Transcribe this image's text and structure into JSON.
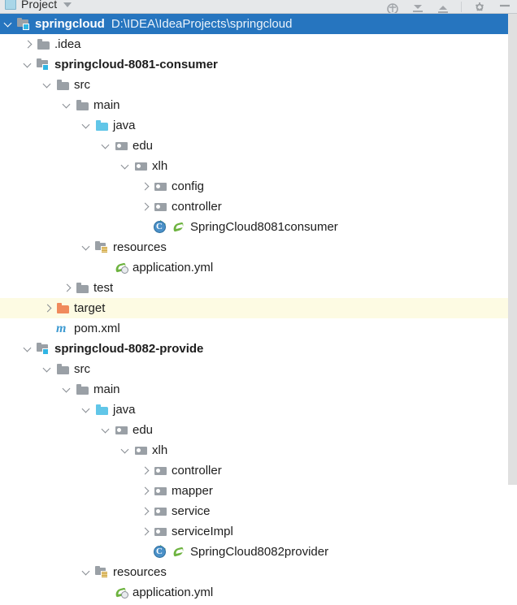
{
  "window": {
    "tool_window_title": "Project",
    "tool_window_icon": "project-icon",
    "caret_icon": "chevron-down-icon",
    "actions": [
      {
        "name": "locate-icon",
        "label": "Select Opened File"
      },
      {
        "name": "collapse-all-icon",
        "label": "Collapse All"
      },
      {
        "name": "expand-all-icon",
        "label": "Expand All"
      },
      {
        "name": "settings-icon",
        "label": "Settings"
      },
      {
        "name": "hide-icon",
        "label": "Hide"
      }
    ]
  },
  "colors": {
    "selection_blue": "#2675bf",
    "hover_yellow": "#fdfbe3",
    "folder_gray": "#9aa0a6",
    "source_root_blue": "#61c6e8",
    "excluded_orange": "#f08a5c",
    "spring_green": "#6db33f",
    "maven_blue": "#3d9ad1",
    "module_badge": "#31b5e4"
  },
  "tree": {
    "rows": [
      {
        "label": "springcloud",
        "sublabel": "D:\\IDEA\\IdeaProjects\\springcloud",
        "depth": 0,
        "icon": "module-folder-icon",
        "twisty": "open",
        "bold": true,
        "state": "selected"
      },
      {
        "label": ".idea",
        "sublabel": "",
        "depth": 1,
        "icon": "folder-icon",
        "twisty": "closed",
        "bold": false,
        "state": "normal"
      },
      {
        "label": "springcloud-8081-consumer",
        "sublabel": "",
        "depth": 1,
        "icon": "module-folder-icon",
        "twisty": "open",
        "bold": true,
        "state": "normal"
      },
      {
        "label": "src",
        "sublabel": "",
        "depth": 2,
        "icon": "folder-icon",
        "twisty": "open",
        "bold": false,
        "state": "normal"
      },
      {
        "label": "main",
        "sublabel": "",
        "depth": 3,
        "icon": "folder-icon",
        "twisty": "open",
        "bold": false,
        "state": "normal"
      },
      {
        "label": "java",
        "sublabel": "",
        "depth": 4,
        "icon": "source-root-folder-icon",
        "twisty": "open",
        "bold": false,
        "state": "normal"
      },
      {
        "label": "edu",
        "sublabel": "",
        "depth": 5,
        "icon": "package-icon",
        "twisty": "open",
        "bold": false,
        "state": "normal"
      },
      {
        "label": "xlh",
        "sublabel": "",
        "depth": 6,
        "icon": "package-icon",
        "twisty": "open",
        "bold": false,
        "state": "normal"
      },
      {
        "label": "config",
        "sublabel": "",
        "depth": 7,
        "icon": "package-icon",
        "twisty": "closed",
        "bold": false,
        "state": "normal"
      },
      {
        "label": "controller",
        "sublabel": "",
        "depth": 7,
        "icon": "package-icon",
        "twisty": "closed",
        "bold": false,
        "state": "normal"
      },
      {
        "label": "SpringCloud8081consumer",
        "sublabel": "",
        "depth": 7,
        "icon": "java-class-runnable-icon",
        "twisty": "none",
        "bold": false,
        "state": "normal",
        "extra_icon": "spring-leaf-icon"
      },
      {
        "label": "resources",
        "sublabel": "",
        "depth": 4,
        "icon": "resources-root-folder-icon",
        "twisty": "open",
        "bold": false,
        "state": "normal"
      },
      {
        "label": "application.yml",
        "sublabel": "",
        "depth": 5,
        "icon": "spring-config-icon",
        "twisty": "none",
        "bold": false,
        "state": "normal"
      },
      {
        "label": "test",
        "sublabel": "",
        "depth": 3,
        "icon": "folder-icon",
        "twisty": "closed",
        "bold": false,
        "state": "normal"
      },
      {
        "label": "target",
        "sublabel": "",
        "depth": 2,
        "icon": "excluded-folder-icon",
        "twisty": "closed",
        "bold": false,
        "state": "hovered"
      },
      {
        "label": "pom.xml",
        "sublabel": "",
        "depth": 2,
        "icon": "maven-icon",
        "twisty": "none",
        "bold": false,
        "state": "normal"
      },
      {
        "label": "springcloud-8082-provide",
        "sublabel": "",
        "depth": 1,
        "icon": "module-folder-icon",
        "twisty": "open",
        "bold": true,
        "state": "normal"
      },
      {
        "label": "src",
        "sublabel": "",
        "depth": 2,
        "icon": "folder-icon",
        "twisty": "open",
        "bold": false,
        "state": "normal"
      },
      {
        "label": "main",
        "sublabel": "",
        "depth": 3,
        "icon": "folder-icon",
        "twisty": "open",
        "bold": false,
        "state": "normal"
      },
      {
        "label": "java",
        "sublabel": "",
        "depth": 4,
        "icon": "source-root-folder-icon",
        "twisty": "open",
        "bold": false,
        "state": "normal"
      },
      {
        "label": "edu",
        "sublabel": "",
        "depth": 5,
        "icon": "package-icon",
        "twisty": "open",
        "bold": false,
        "state": "normal"
      },
      {
        "label": "xlh",
        "sublabel": "",
        "depth": 6,
        "icon": "package-icon",
        "twisty": "open",
        "bold": false,
        "state": "normal"
      },
      {
        "label": "controller",
        "sublabel": "",
        "depth": 7,
        "icon": "package-icon",
        "twisty": "closed",
        "bold": false,
        "state": "normal"
      },
      {
        "label": "mapper",
        "sublabel": "",
        "depth": 7,
        "icon": "package-icon",
        "twisty": "closed",
        "bold": false,
        "state": "normal"
      },
      {
        "label": "service",
        "sublabel": "",
        "depth": 7,
        "icon": "package-icon",
        "twisty": "closed",
        "bold": false,
        "state": "normal"
      },
      {
        "label": "serviceImpl",
        "sublabel": "",
        "depth": 7,
        "icon": "package-icon",
        "twisty": "closed",
        "bold": false,
        "state": "normal"
      },
      {
        "label": "SpringCloud8082provider",
        "sublabel": "",
        "depth": 7,
        "icon": "java-class-runnable-icon",
        "twisty": "none",
        "bold": false,
        "state": "normal",
        "extra_icon": "spring-leaf-icon"
      },
      {
        "label": "resources",
        "sublabel": "",
        "depth": 4,
        "icon": "resources-root-folder-icon",
        "twisty": "open",
        "bold": false,
        "state": "normal"
      },
      {
        "label": "application.yml",
        "sublabel": "",
        "depth": 5,
        "icon": "spring-config-icon",
        "twisty": "none",
        "bold": false,
        "state": "normal"
      }
    ]
  }
}
